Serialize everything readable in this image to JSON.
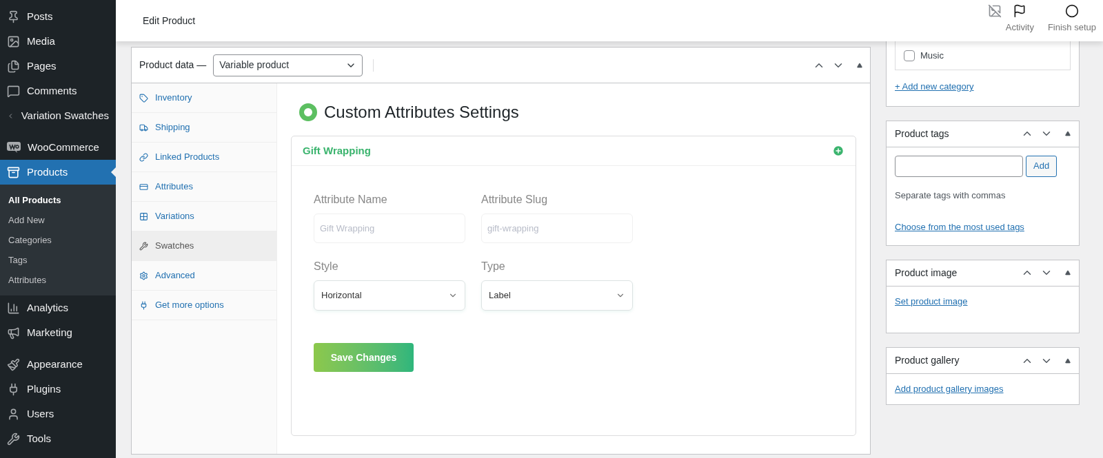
{
  "sidebar": {
    "groups": [
      {
        "items": [
          {
            "label": "Posts",
            "selected": false
          },
          {
            "label": "Media",
            "selected": false
          },
          {
            "label": "Pages",
            "selected": false
          },
          {
            "label": "Comments",
            "selected": false
          },
          {
            "label": "Variation Swatches",
            "selected": false
          }
        ]
      },
      {
        "items": [
          {
            "label": "WooCommerce",
            "selected": false
          },
          {
            "label": "Products",
            "selected": true,
            "children": [
              {
                "label": "All Products",
                "selected": true
              },
              {
                "label": "Add New",
                "selected": false
              },
              {
                "label": "Categories",
                "selected": false
              },
              {
                "label": "Tags",
                "selected": false
              },
              {
                "label": "Attributes",
                "selected": false
              }
            ]
          },
          {
            "label": "Analytics",
            "selected": false
          },
          {
            "label": "Marketing",
            "selected": false
          }
        ]
      },
      {
        "items": [
          {
            "label": "Appearance",
            "selected": false
          },
          {
            "label": "Plugins",
            "selected": false
          },
          {
            "label": "Users",
            "selected": false
          },
          {
            "label": "Tools",
            "selected": false
          }
        ]
      }
    ]
  },
  "topbar": {
    "title": "Edit Product",
    "actions": [
      {
        "label": "Activity"
      },
      {
        "label": "Finish setup"
      }
    ]
  },
  "product_data": {
    "label": "Product data —",
    "type_select": {
      "value": "Variable product"
    },
    "tabs": [
      {
        "label": "Inventory",
        "selected": false
      },
      {
        "label": "Shipping",
        "selected": false
      },
      {
        "label": "Linked Products",
        "selected": false
      },
      {
        "label": "Attributes",
        "selected": false
      },
      {
        "label": "Variations",
        "selected": false
      },
      {
        "label": "Swatches",
        "selected": true
      },
      {
        "label": "Advanced",
        "selected": false
      },
      {
        "label": "Get more options",
        "selected": false
      }
    ],
    "panel": {
      "title": "Custom Attributes Settings",
      "attribute": {
        "name": "Gift Wrapping",
        "fields": [
          {
            "kind": "input",
            "label": "Attribute Name",
            "placeholder": "Gift Wrapping"
          },
          {
            "kind": "input",
            "label": "Attribute Slug",
            "placeholder": "gift-wrapping"
          },
          {
            "kind": "select",
            "label": "Style",
            "value": "Horizontal"
          },
          {
            "kind": "select",
            "label": "Type",
            "value": "Label"
          }
        ],
        "save_button": "Save Changes"
      }
    }
  },
  "right_column": {
    "categories": {
      "items": [
        {
          "label": "Music",
          "checked": false
        }
      ],
      "add_link": "+ Add new category"
    },
    "tags": {
      "title": "Product tags",
      "add_button": "Add",
      "hint": "Separate tags with commas",
      "link": "Choose from the most used tags"
    },
    "image": {
      "title": "Product image",
      "link": "Set product image"
    },
    "gallery": {
      "title": "Product gallery",
      "link": "Add product gallery images"
    }
  }
}
